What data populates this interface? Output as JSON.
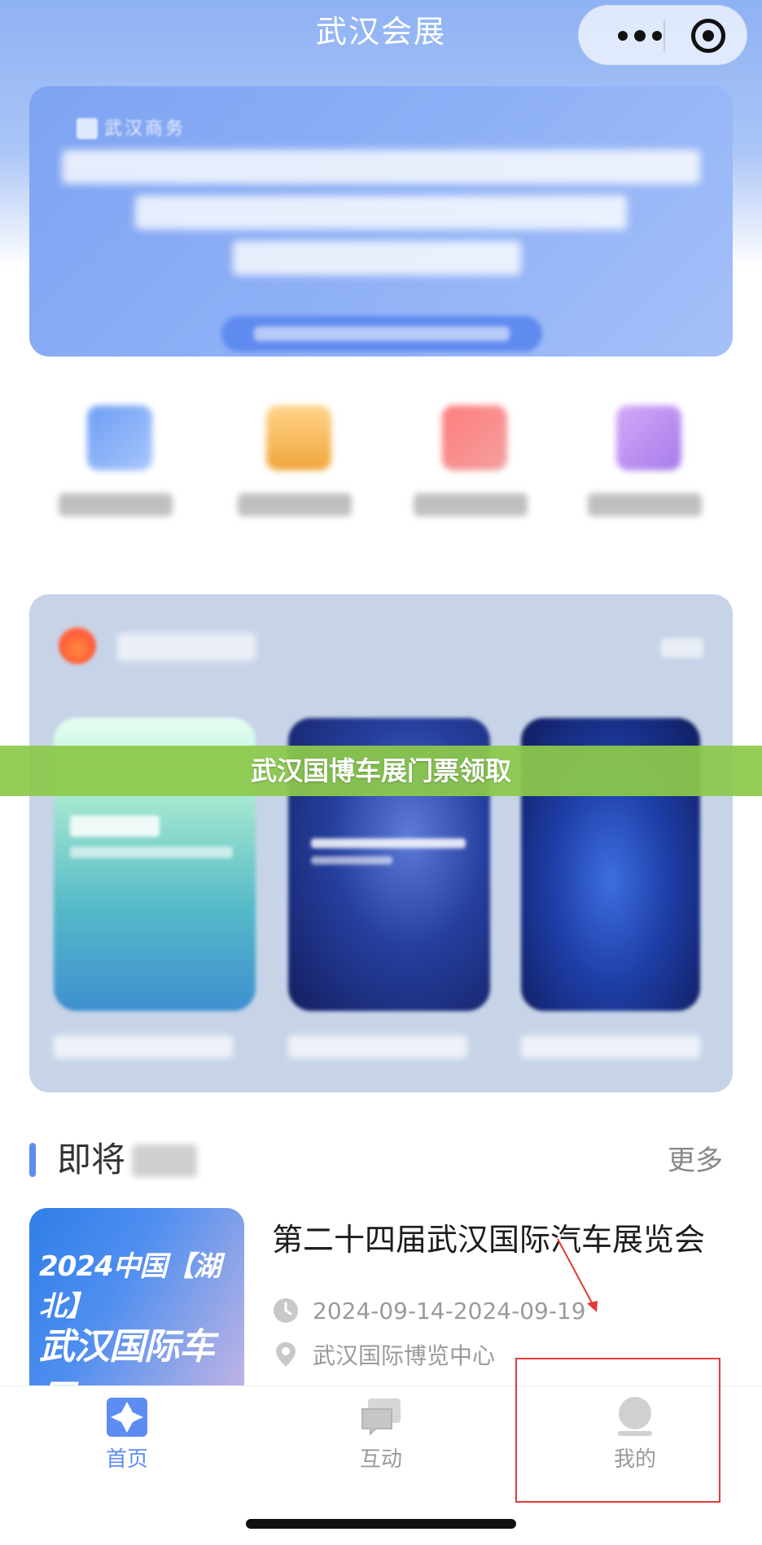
{
  "nav": {
    "title": "武汉会展"
  },
  "banner": {
    "logo_text": "武汉商务"
  },
  "overlay": {
    "text": "武汉国博车展门票领取"
  },
  "upcoming": {
    "title_visible": "即将",
    "more": "更多",
    "event": {
      "thumb_line1": "2024中国【湖北】",
      "thumb_line2": "武汉国际车展",
      "title": "第二十四届武汉国际汽车展览会",
      "date": "2024-09-14-2024-09-19",
      "venue": "武汉国际博览中心"
    }
  },
  "tabs": [
    {
      "label": "首页",
      "icon": "home-icon",
      "active": true
    },
    {
      "label": "互动",
      "icon": "chat-icon",
      "active": false
    },
    {
      "label": "我的",
      "icon": "user-icon",
      "active": false
    }
  ],
  "colors": {
    "accent": "#5d8cf2",
    "overlay_green": "#8cc94a",
    "annotation_red": "#e53935"
  }
}
